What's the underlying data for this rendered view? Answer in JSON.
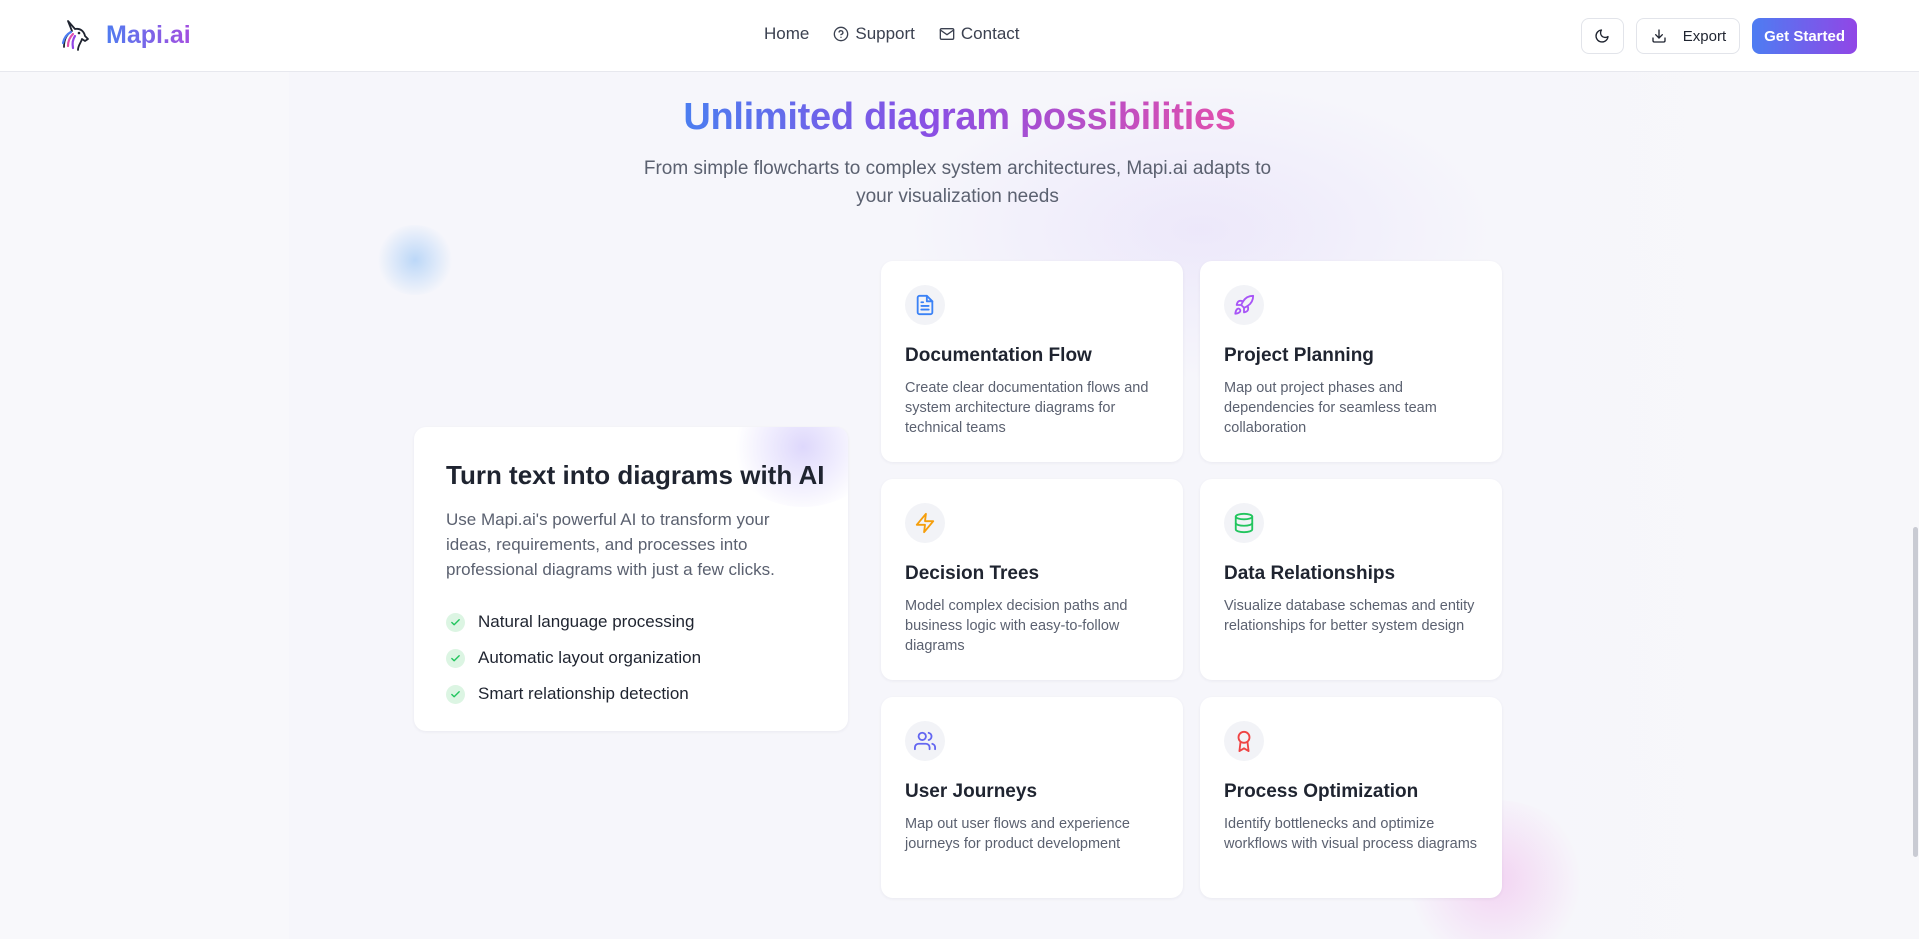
{
  "header": {
    "brand": "Mapi.ai",
    "nav": [
      {
        "label": "Home",
        "icon": ""
      },
      {
        "label": "Support",
        "icon": "help-circle-icon"
      },
      {
        "label": "Contact",
        "icon": "mail-icon"
      }
    ],
    "theme_toggle_icon": "moon-icon",
    "export_label": "Export",
    "cta_label": "Get Started"
  },
  "hero": {
    "title": "Unlimited diagram possibilities",
    "subtitle": "From simple flowcharts to complex system architectures, Mapi.ai adapts to your visualization needs"
  },
  "panel": {
    "title": "Turn text into diagrams with AI",
    "description": "Use Mapi.ai's powerful AI to transform your ideas, requirements, and processes into professional diagrams with just a few clicks.",
    "features": [
      "Natural language processing",
      "Automatic layout organization",
      "Smart relationship detection"
    ]
  },
  "cards": [
    {
      "title": "Documentation Flow",
      "description": "Create clear documentation flows and system architecture diagrams for technical teams",
      "icon": "file-text-icon",
      "color": "#3b82f6"
    },
    {
      "title": "Project Planning",
      "description": "Map out project phases and dependencies for seamless team collaboration",
      "icon": "rocket-icon",
      "color": "#a855f7"
    },
    {
      "title": "Decision Trees",
      "description": "Model complex decision paths and business logic with easy-to-follow diagrams",
      "icon": "zap-icon",
      "color": "#f59e0b"
    },
    {
      "title": "Data Relationships",
      "description": "Visualize database schemas and entity relationships for better system design",
      "icon": "database-icon",
      "color": "#22c55e"
    },
    {
      "title": "User Journeys",
      "description": "Map out user flows and experience journeys for product development",
      "icon": "users-icon",
      "color": "#6366f1"
    },
    {
      "title": "Process Optimization",
      "description": "Identify bottlenecks and optimize workflows with visual process diagrams",
      "icon": "award-icon",
      "color": "#ef4444"
    }
  ],
  "colors": {
    "accent_blue": "#4d7df2",
    "accent_purple": "#9146e6",
    "accent_pink": "#e24fac",
    "check_green": "#22c55e"
  }
}
